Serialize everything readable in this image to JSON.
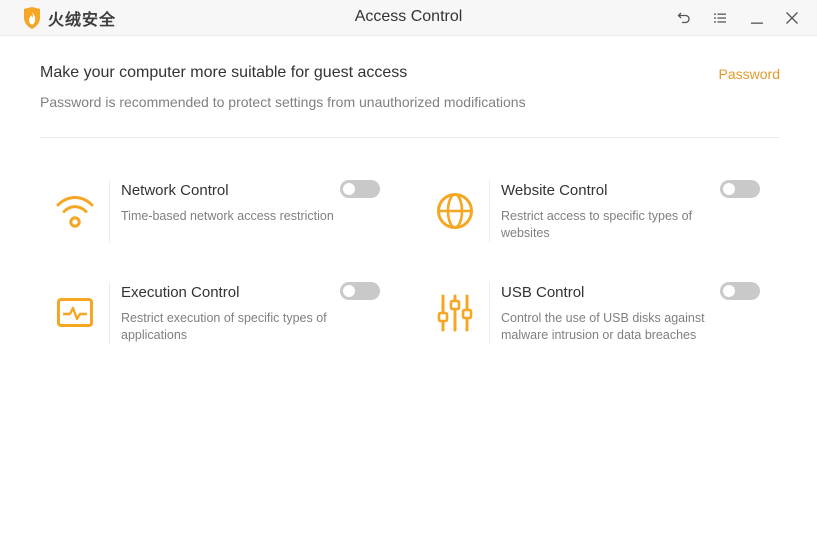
{
  "app": {
    "brand": "火绒安全",
    "window_title": "Access Control"
  },
  "header": {
    "heading": "Make your computer more suitable for guest access",
    "subheading": "Password is recommended to protect settings from unauthorized modifications",
    "password_link": "Password"
  },
  "controls": [
    {
      "title": "Network Control",
      "description": "Time-based network access restriction",
      "icon": "wifi-icon",
      "enabled": false
    },
    {
      "title": "Website Control",
      "description": "Restrict access to specific types of websites",
      "icon": "globe-icon",
      "enabled": false
    },
    {
      "title": "Execution Control",
      "description": "Restrict execution of specific types of applications",
      "icon": "monitor-pulse-icon",
      "enabled": false
    },
    {
      "title": "USB Control",
      "description": "Control the use of USB disks against malware intrusion or data breaches",
      "icon": "sliders-icon",
      "enabled": false
    }
  ],
  "colors": {
    "accent": "#f5a623",
    "link": "#e39a2b",
    "toggle_off": "#c9c9c9"
  }
}
